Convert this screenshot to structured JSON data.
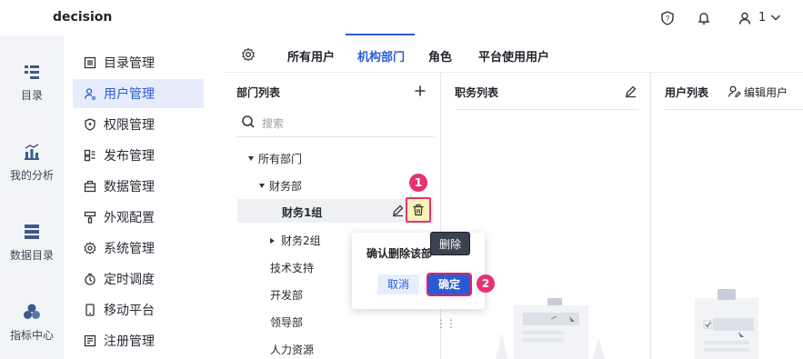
{
  "app": {
    "title": "decision"
  },
  "topbar": {
    "user_count": "1"
  },
  "rail": [
    {
      "label": "目录",
      "icon": "catalog-icon"
    },
    {
      "label": "我的分析",
      "icon": "analysis-icon"
    },
    {
      "label": "数据目录",
      "icon": "data-catalog-icon"
    },
    {
      "label": "指标中心",
      "icon": "metrics-icon"
    }
  ],
  "menu": [
    {
      "label": "目录管理",
      "icon": "list-icon"
    },
    {
      "label": "用户管理",
      "icon": "user-icon",
      "active": true
    },
    {
      "label": "权限管理",
      "icon": "shield-icon"
    },
    {
      "label": "发布管理",
      "icon": "publish-icon"
    },
    {
      "label": "数据管理",
      "icon": "database-icon"
    },
    {
      "label": "外观配置",
      "icon": "brush-icon"
    },
    {
      "label": "系统管理",
      "icon": "gear-icon"
    },
    {
      "label": "定时调度",
      "icon": "timer-icon"
    },
    {
      "label": "移动平台",
      "icon": "mobile-icon"
    },
    {
      "label": "注册管理",
      "icon": "register-icon"
    }
  ],
  "tabs": [
    {
      "label": "所有用户"
    },
    {
      "label": "机构部门",
      "active": true
    },
    {
      "label": "角色"
    },
    {
      "label": "平台使用用户"
    }
  ],
  "panels": {
    "dept_title": "部门列表",
    "position_title": "职务列表",
    "user_title": "用户列表",
    "edit_users": "编辑用户"
  },
  "search": {
    "placeholder": "搜索"
  },
  "tree": [
    {
      "label": "所有部门",
      "caret": "down"
    },
    {
      "label": "财务部",
      "caret": "down"
    },
    {
      "label": "财务1组",
      "selected": true
    },
    {
      "label": "财务2组",
      "caret": "right"
    },
    {
      "label": "技术支持"
    },
    {
      "label": "开发部"
    },
    {
      "label": "领导部"
    },
    {
      "label": "人力资源"
    }
  ],
  "popover": {
    "text": "确认删除该部",
    "cancel": "取消",
    "ok": "确定"
  },
  "tooltip": {
    "text": "删除"
  },
  "badges": {
    "first": "1",
    "second": "2"
  },
  "colors": {
    "accent": "#2a5bd7",
    "badge": "#e5336f",
    "highlight": "#f7f3b9"
  }
}
